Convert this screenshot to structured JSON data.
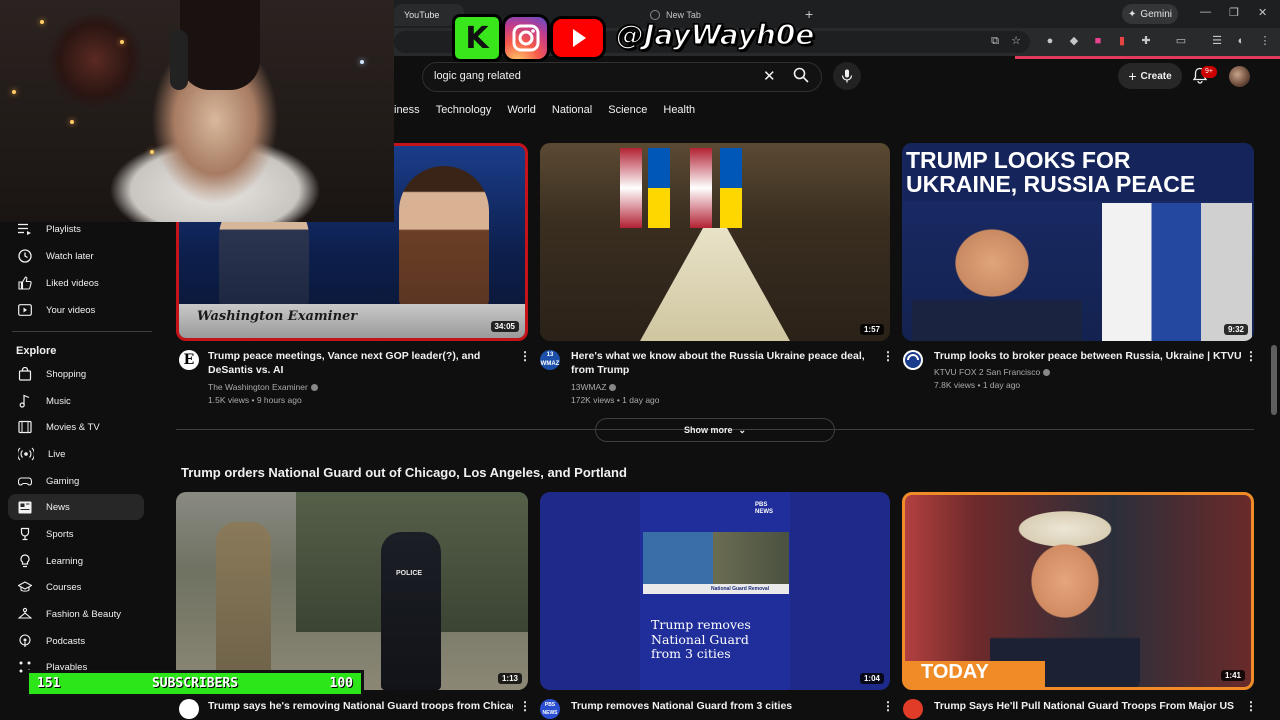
{
  "browser": {
    "tabs": [
      {
        "label": "YouTube",
        "active": true
      },
      {
        "label": "New Tab",
        "active": false
      }
    ],
    "gemini_label": "Gemini",
    "accent_color": "#e23a5a"
  },
  "header": {
    "search_query": "logic gang related",
    "create_label": "Create",
    "notification_badge": "9+"
  },
  "topic_tabs": [
    "Business",
    "Technology",
    "World",
    "National",
    "Science",
    "Health"
  ],
  "topic_tabs_visible": [
    "iness",
    "Technology",
    "World",
    "National",
    "Science",
    "Health"
  ],
  "sidebar": {
    "items_top": [
      {
        "label": "Playlists",
        "icon": "playlist-icon"
      },
      {
        "label": "Watch later",
        "icon": "clock-icon"
      },
      {
        "label": "Liked videos",
        "icon": "thumbs-up-icon"
      },
      {
        "label": "Your videos",
        "icon": "play-square-icon"
      }
    ],
    "explore_heading": "Explore",
    "explore_items": [
      {
        "label": "Shopping",
        "icon": "shopping-bag-icon"
      },
      {
        "label": "Music",
        "icon": "music-note-icon"
      },
      {
        "label": "Movies & TV",
        "icon": "film-icon"
      },
      {
        "label": "Live",
        "icon": "live-icon"
      },
      {
        "label": "Gaming",
        "icon": "gamepad-icon"
      },
      {
        "label": "News",
        "icon": "newspaper-icon",
        "active": true
      },
      {
        "label": "Sports",
        "icon": "trophy-icon"
      },
      {
        "label": "Learning",
        "icon": "lightbulb-icon"
      },
      {
        "label": "Courses",
        "icon": "graduation-cap-icon"
      },
      {
        "label": "Fashion & Beauty",
        "icon": "hanger-icon"
      },
      {
        "label": "Podcasts",
        "icon": "podcast-icon"
      },
      {
        "label": "Playables",
        "icon": "playables-icon"
      }
    ]
  },
  "overlay": {
    "ko_text": "K",
    "handle": "@JayWayh0e",
    "subscribers_label": "SUBSCRIBERS",
    "subscribers_count": "151",
    "subscribers_goal": "100"
  },
  "videos_row1": [
    {
      "title": "Trump peace meetings, Vance next GOP leader(?), and DeSantis vs. AI",
      "channel": "The Washington Examiner",
      "views": "1.5K views",
      "age": "9 hours ago",
      "duration": "34:05",
      "thumb_text": "Washington Examiner"
    },
    {
      "title": "Here's what we know about the Russia Ukraine peace deal, from Trump",
      "channel": "13WMAZ",
      "views": "172K views",
      "age": "1 day ago",
      "duration": "1:57",
      "avatar_text": "13 WMAZ"
    },
    {
      "title": "Trump looks to broker peace between Russia, Ukraine | KTVU",
      "channel": "KTVU FOX 2 San Francisco",
      "views": "7.8K views",
      "age": "1 day ago",
      "duration": "9:32",
      "thumb_text_1": "TRUMP LOOKS FOR",
      "thumb_text_2": "UKRAINE, RUSSIA PEACE"
    }
  ],
  "show_more_label": "Show more",
  "section_title": "Trump orders National Guard out of Chicago, Los Angeles, and Portland",
  "videos_row2": [
    {
      "title": "Trump says he's removing National Guard troops from Chicago,",
      "duration": "1:13",
      "thumb_text": "POLICE"
    },
    {
      "title": "Trump removes National Guard from 3 cities",
      "duration": "1:04",
      "thumb_text": "Trump removes National Guard from 3 cities",
      "thumb_caption": "National Guard Removal",
      "logo": "PBS NEWS"
    },
    {
      "title": "Trump Says He'll Pull National Guard Troops From Major US",
      "duration": "1:41",
      "thumb_text": "TODAY"
    }
  ]
}
